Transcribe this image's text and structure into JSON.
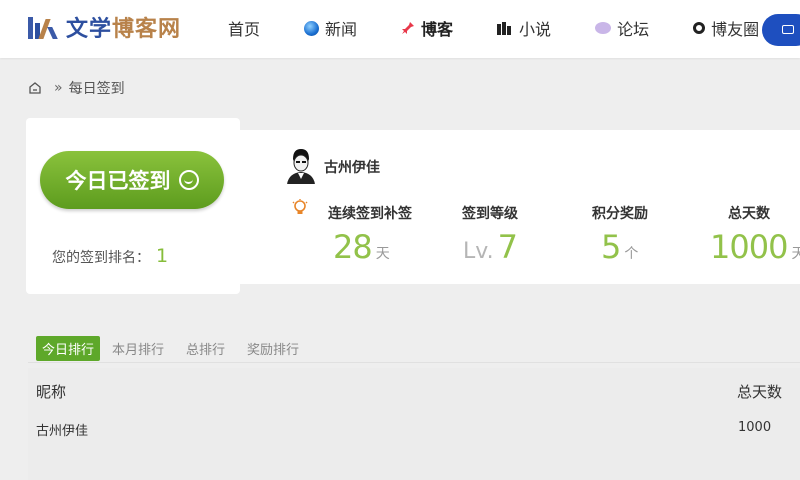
{
  "logo": {
    "part1": "文学",
    "part2": "博客网"
  },
  "nav": [
    {
      "label": "首页",
      "icon": ""
    },
    {
      "label": "新闻",
      "icon": "globe-icon"
    },
    {
      "label": "博客",
      "icon": "pin-icon"
    },
    {
      "label": "小说",
      "icon": "books-icon"
    },
    {
      "label": "论坛",
      "icon": "chat-bubble-icon"
    },
    {
      "label": "博友圈",
      "icon": "ring-icon"
    }
  ],
  "breadcrumb": {
    "separator": "»",
    "current": "每日签到"
  },
  "sign": {
    "button_label": "今日已签到",
    "rank_label": "您的签到排名：",
    "rank_value": "1"
  },
  "user": {
    "name": "古州伊佳"
  },
  "stats": [
    {
      "label": "连续签到补签",
      "value": "28",
      "prefix": "",
      "unit": "天"
    },
    {
      "label": "签到等级",
      "value": "7",
      "prefix": "Lv.",
      "unit": ""
    },
    {
      "label": "积分奖励",
      "value": "5",
      "prefix": "",
      "unit": "个"
    },
    {
      "label": "总天数",
      "value": "1000",
      "prefix": "",
      "unit": "天"
    }
  ],
  "tabs": [
    "今日排行",
    "本月排行",
    "总排行",
    "奖励排行"
  ],
  "table": {
    "headers": {
      "nickname": "昵称",
      "total_days": "总天数"
    },
    "rows": [
      {
        "nickname": "古州伊佳",
        "total_days": "1000"
      }
    ]
  },
  "colors": {
    "accent_green": "#5ea82a",
    "value_green": "#92c24a",
    "header_button": "#1e4fbf"
  }
}
